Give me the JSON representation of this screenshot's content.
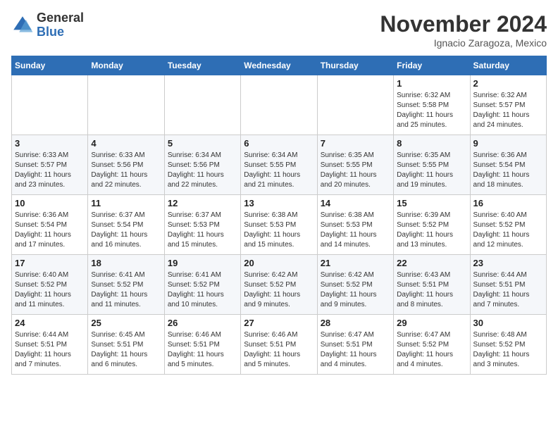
{
  "header": {
    "logo_line1": "General",
    "logo_line2": "Blue",
    "month_year": "November 2024",
    "location": "Ignacio Zaragoza, Mexico"
  },
  "calendar": {
    "days_of_week": [
      "Sunday",
      "Monday",
      "Tuesday",
      "Wednesday",
      "Thursday",
      "Friday",
      "Saturday"
    ],
    "weeks": [
      [
        {
          "day": "",
          "info": ""
        },
        {
          "day": "",
          "info": ""
        },
        {
          "day": "",
          "info": ""
        },
        {
          "day": "",
          "info": ""
        },
        {
          "day": "",
          "info": ""
        },
        {
          "day": "1",
          "info": "Sunrise: 6:32 AM\nSunset: 5:58 PM\nDaylight: 11 hours\nand 25 minutes."
        },
        {
          "day": "2",
          "info": "Sunrise: 6:32 AM\nSunset: 5:57 PM\nDaylight: 11 hours\nand 24 minutes."
        }
      ],
      [
        {
          "day": "3",
          "info": "Sunrise: 6:33 AM\nSunset: 5:57 PM\nDaylight: 11 hours\nand 23 minutes."
        },
        {
          "day": "4",
          "info": "Sunrise: 6:33 AM\nSunset: 5:56 PM\nDaylight: 11 hours\nand 22 minutes."
        },
        {
          "day": "5",
          "info": "Sunrise: 6:34 AM\nSunset: 5:56 PM\nDaylight: 11 hours\nand 22 minutes."
        },
        {
          "day": "6",
          "info": "Sunrise: 6:34 AM\nSunset: 5:55 PM\nDaylight: 11 hours\nand 21 minutes."
        },
        {
          "day": "7",
          "info": "Sunrise: 6:35 AM\nSunset: 5:55 PM\nDaylight: 11 hours\nand 20 minutes."
        },
        {
          "day": "8",
          "info": "Sunrise: 6:35 AM\nSunset: 5:55 PM\nDaylight: 11 hours\nand 19 minutes."
        },
        {
          "day": "9",
          "info": "Sunrise: 6:36 AM\nSunset: 5:54 PM\nDaylight: 11 hours\nand 18 minutes."
        }
      ],
      [
        {
          "day": "10",
          "info": "Sunrise: 6:36 AM\nSunset: 5:54 PM\nDaylight: 11 hours\nand 17 minutes."
        },
        {
          "day": "11",
          "info": "Sunrise: 6:37 AM\nSunset: 5:54 PM\nDaylight: 11 hours\nand 16 minutes."
        },
        {
          "day": "12",
          "info": "Sunrise: 6:37 AM\nSunset: 5:53 PM\nDaylight: 11 hours\nand 15 minutes."
        },
        {
          "day": "13",
          "info": "Sunrise: 6:38 AM\nSunset: 5:53 PM\nDaylight: 11 hours\nand 15 minutes."
        },
        {
          "day": "14",
          "info": "Sunrise: 6:38 AM\nSunset: 5:53 PM\nDaylight: 11 hours\nand 14 minutes."
        },
        {
          "day": "15",
          "info": "Sunrise: 6:39 AM\nSunset: 5:52 PM\nDaylight: 11 hours\nand 13 minutes."
        },
        {
          "day": "16",
          "info": "Sunrise: 6:40 AM\nSunset: 5:52 PM\nDaylight: 11 hours\nand 12 minutes."
        }
      ],
      [
        {
          "day": "17",
          "info": "Sunrise: 6:40 AM\nSunset: 5:52 PM\nDaylight: 11 hours\nand 11 minutes."
        },
        {
          "day": "18",
          "info": "Sunrise: 6:41 AM\nSunset: 5:52 PM\nDaylight: 11 hours\nand 11 minutes."
        },
        {
          "day": "19",
          "info": "Sunrise: 6:41 AM\nSunset: 5:52 PM\nDaylight: 11 hours\nand 10 minutes."
        },
        {
          "day": "20",
          "info": "Sunrise: 6:42 AM\nSunset: 5:52 PM\nDaylight: 11 hours\nand 9 minutes."
        },
        {
          "day": "21",
          "info": "Sunrise: 6:42 AM\nSunset: 5:52 PM\nDaylight: 11 hours\nand 9 minutes."
        },
        {
          "day": "22",
          "info": "Sunrise: 6:43 AM\nSunset: 5:51 PM\nDaylight: 11 hours\nand 8 minutes."
        },
        {
          "day": "23",
          "info": "Sunrise: 6:44 AM\nSunset: 5:51 PM\nDaylight: 11 hours\nand 7 minutes."
        }
      ],
      [
        {
          "day": "24",
          "info": "Sunrise: 6:44 AM\nSunset: 5:51 PM\nDaylight: 11 hours\nand 7 minutes."
        },
        {
          "day": "25",
          "info": "Sunrise: 6:45 AM\nSunset: 5:51 PM\nDaylight: 11 hours\nand 6 minutes."
        },
        {
          "day": "26",
          "info": "Sunrise: 6:46 AM\nSunset: 5:51 PM\nDaylight: 11 hours\nand 5 minutes."
        },
        {
          "day": "27",
          "info": "Sunrise: 6:46 AM\nSunset: 5:51 PM\nDaylight: 11 hours\nand 5 minutes."
        },
        {
          "day": "28",
          "info": "Sunrise: 6:47 AM\nSunset: 5:51 PM\nDaylight: 11 hours\nand 4 minutes."
        },
        {
          "day": "29",
          "info": "Sunrise: 6:47 AM\nSunset: 5:52 PM\nDaylight: 11 hours\nand 4 minutes."
        },
        {
          "day": "30",
          "info": "Sunrise: 6:48 AM\nSunset: 5:52 PM\nDaylight: 11 hours\nand 3 minutes."
        }
      ]
    ]
  }
}
